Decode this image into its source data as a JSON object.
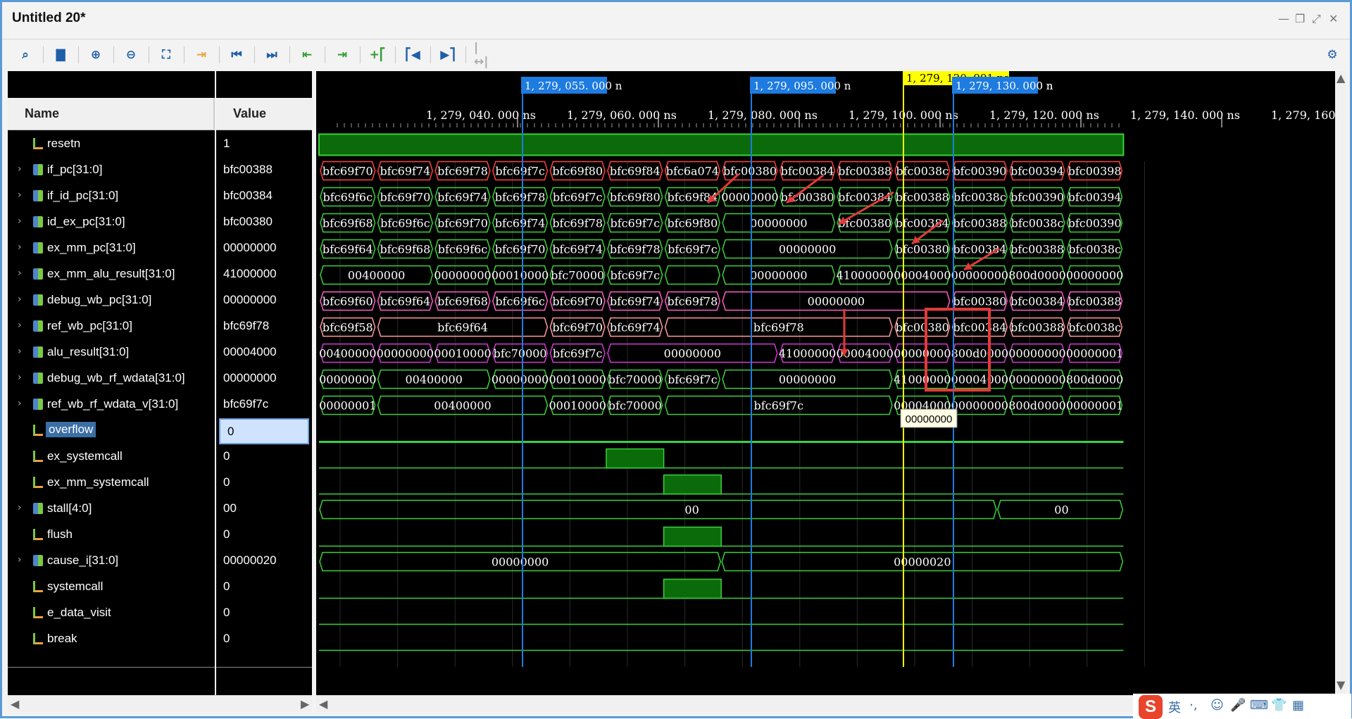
{
  "window": {
    "title": "Untitled 20*"
  },
  "toolbar": {
    "icons": [
      "search-icon",
      "save-icon",
      "zoom-in-icon",
      "zoom-out-icon",
      "zoom-fit-icon",
      "go-to-cursor-icon",
      "go-to-start-icon",
      "go-to-end-icon",
      "previous-transition-icon",
      "next-transition-icon",
      "add-marker-icon",
      "previous-marker-icon",
      "next-marker-icon",
      "swap-cursors-icon"
    ],
    "settings_icon": "gear-icon"
  },
  "columns": {
    "name": "Name",
    "value": "Value"
  },
  "signals": [
    {
      "name": "resetn",
      "value": "1",
      "bus": false
    },
    {
      "name": "if_pc[31:0]",
      "value": "bfc00388",
      "bus": true
    },
    {
      "name": "if_id_pc[31:0]",
      "value": "bfc00384",
      "bus": true
    },
    {
      "name": "id_ex_pc[31:0]",
      "value": "bfc00380",
      "bus": true
    },
    {
      "name": "ex_mm_pc[31:0]",
      "value": "00000000",
      "bus": true
    },
    {
      "name": "ex_mm_alu_result[31:0]",
      "value": "41000000",
      "bus": true
    },
    {
      "name": "debug_wb_pc[31:0]",
      "value": "00000000",
      "bus": true
    },
    {
      "name": "ref_wb_pc[31:0]",
      "value": "bfc69f78",
      "bus": true
    },
    {
      "name": "alu_result[31:0]",
      "value": "00004000",
      "bus": true
    },
    {
      "name": "debug_wb_rf_wdata[31:0]",
      "value": "00000000",
      "bus": true
    },
    {
      "name": "ref_wb_rf_wdata_v[31:0]",
      "value": "bfc69f7c",
      "bus": true
    },
    {
      "name": "overflow",
      "value": "0",
      "bus": false
    },
    {
      "name": "ex_systemcall",
      "value": "0",
      "bus": false
    },
    {
      "name": "ex_mm_systemcall",
      "value": "0",
      "bus": false
    },
    {
      "name": "stall[4:0]",
      "value": "00",
      "bus": true
    },
    {
      "name": "flush",
      "value": "0",
      "bus": false
    },
    {
      "name": "cause_i[31:0]",
      "value": "00000020",
      "bus": true
    },
    {
      "name": "systemcall",
      "value": "0",
      "bus": false
    },
    {
      "name": "e_data_visit",
      "value": "0",
      "bus": false
    },
    {
      "name": "break",
      "value": "0",
      "bus": false
    }
  ],
  "time_axis": {
    "ticks": [
      "1, 279, 040. 000 ns",
      "1, 279, 060. 000 ns",
      "1, 279, 080. 000 ns",
      "1, 279, 100. 000 ns",
      "1, 279, 120. 000 ns",
      "1, 279, 140. 000 ns",
      "1, 279, 160."
    ],
    "markers": [
      "1, 279, 055. 000 n",
      "1, 279, 095. 000 n",
      "1, 279, 130. 000 n"
    ],
    "cursor": "1, 279, 120. 991 ns",
    "marker_color": "#1e7be0",
    "cursor_color": "#ffff00"
  },
  "tooltip": "00000000",
  "bus_rows": [
    {
      "color": "#ff4040",
      "segs": [
        [
          "bfc69f70",
          0,
          1
        ],
        [
          "bfc69f74",
          1,
          2
        ],
        [
          "bfc69f78",
          2,
          3
        ],
        [
          "bfc69f7c",
          3,
          4
        ],
        [
          "bfc69f80",
          4,
          5
        ],
        [
          "bfc69f84",
          5,
          6
        ],
        [
          "bfc6a074",
          6,
          7
        ],
        [
          "bfc00380",
          7,
          8
        ],
        [
          "bfc00384",
          8,
          9
        ],
        [
          "bfc00388",
          9,
          10
        ],
        [
          "bfc0038c",
          10,
          11
        ],
        [
          "bfc00390",
          11,
          12
        ],
        [
          "bfc00394",
          12,
          13
        ],
        [
          "bfc00398",
          13,
          14
        ]
      ]
    },
    {
      "color": "#3ad13a",
      "segs": [
        [
          "bfc69f6c",
          0,
          1
        ],
        [
          "bfc69f70",
          1,
          2
        ],
        [
          "bfc69f74",
          2,
          3
        ],
        [
          "bfc69f78",
          3,
          4
        ],
        [
          "bfc69f7c",
          4,
          5
        ],
        [
          "bfc69f80",
          5,
          6
        ],
        [
          "bfc69f84",
          6,
          7
        ],
        [
          "00000000",
          7,
          8
        ],
        [
          "bfc00380",
          8,
          9
        ],
        [
          "bfc00384",
          9,
          10
        ],
        [
          "bfc00388",
          10,
          11
        ],
        [
          "bfc0038c",
          11,
          12
        ],
        [
          "bfc00390",
          12,
          13
        ],
        [
          "bfc00394",
          13,
          14
        ]
      ]
    },
    {
      "color": "#3ad13a",
      "segs": [
        [
          "bfc69f68",
          0,
          1
        ],
        [
          "bfc69f6c",
          1,
          2
        ],
        [
          "bfc69f70",
          2,
          3
        ],
        [
          "bfc69f74",
          3,
          4
        ],
        [
          "bfc69f78",
          4,
          5
        ],
        [
          "bfc69f7c",
          5,
          6
        ],
        [
          "bfc69f80",
          6,
          7
        ],
        [
          "00000000",
          7,
          9
        ],
        [
          "bfc00380",
          9,
          10
        ],
        [
          "bfc00384",
          10,
          11
        ],
        [
          "bfc00388",
          11,
          12
        ],
        [
          "bfc0038c",
          12,
          13
        ],
        [
          "bfc00390",
          13,
          14
        ]
      ]
    },
    {
      "color": "#3ad13a",
      "segs": [
        [
          "bfc69f64",
          0,
          1
        ],
        [
          "bfc69f68",
          1,
          2
        ],
        [
          "bfc69f6c",
          2,
          3
        ],
        [
          "bfc69f70",
          3,
          4
        ],
        [
          "bfc69f74",
          4,
          5
        ],
        [
          "bfc69f78",
          5,
          6
        ],
        [
          "bfc69f7c",
          6,
          7
        ],
        [
          "00000000",
          7,
          10
        ],
        [
          "bfc00380",
          10,
          11
        ],
        [
          "bfc00384",
          11,
          12
        ],
        [
          "bfc00388",
          12,
          13
        ],
        [
          "bfc0038c",
          13,
          14
        ]
      ]
    },
    {
      "color": "#3ad13a",
      "segs": [
        [
          "00400000",
          0,
          2
        ],
        [
          "00000000",
          2,
          3
        ],
        [
          "00010000",
          3,
          4
        ],
        [
          "bfc70000",
          4,
          5
        ],
        [
          "bfc69f7c",
          5,
          6
        ],
        [
          "",
          6,
          7
        ],
        [
          "00000000",
          7,
          9
        ],
        [
          "41000000",
          9,
          10
        ],
        [
          "00004000",
          10,
          11
        ],
        [
          "00000000",
          11,
          12
        ],
        [
          "800d0000",
          12,
          13
        ],
        [
          "00000000",
          13,
          14
        ]
      ]
    },
    {
      "color": "#ff5cc8",
      "segs": [
        [
          "bfc69f60",
          0,
          1
        ],
        [
          "bfc69f64",
          1,
          2
        ],
        [
          "bfc69f68",
          2,
          3
        ],
        [
          "bfc69f6c",
          3,
          4
        ],
        [
          "bfc69f70",
          4,
          5
        ],
        [
          "bfc69f74",
          5,
          6
        ],
        [
          "bfc69f78",
          6,
          7
        ],
        [
          "00000000",
          7,
          11
        ],
        [
          "bfc00380",
          11,
          12
        ],
        [
          "bfc00384",
          12,
          13
        ],
        [
          "bfc00388",
          13,
          14
        ]
      ]
    },
    {
      "color": "#ff9a9a",
      "segs": [
        [
          "bfc69f58",
          0,
          1
        ],
        [
          "bfc69f64",
          1,
          4
        ],
        [
          "bfc69f70",
          4,
          5
        ],
        [
          "bfc69f74",
          5,
          6
        ],
        [
          "bfc69f78",
          6,
          10
        ],
        [
          "bfc00380",
          10,
          11
        ],
        [
          "bfc00384",
          11,
          12
        ],
        [
          "bfc00388",
          12,
          13
        ],
        [
          "bfc0038c",
          13,
          14
        ]
      ]
    },
    {
      "color": "#d23ad2",
      "segs": [
        [
          "00400000",
          0,
          1
        ],
        [
          "00000000",
          1,
          2
        ],
        [
          "00010000",
          2,
          3
        ],
        [
          "bfc70000",
          3,
          4
        ],
        [
          "bfc69f7c",
          4,
          5
        ],
        [
          "00000000",
          5,
          8
        ],
        [
          "41000000",
          8,
          9
        ],
        [
          "00004000",
          9,
          10
        ],
        [
          "00000000",
          10,
          11
        ],
        [
          "800d0000",
          11,
          12
        ],
        [
          "00000000",
          12,
          13
        ],
        [
          "00000001",
          13,
          14
        ]
      ]
    },
    {
      "color": "#3ad13a",
      "segs": [
        [
          "00000000",
          0,
          1
        ],
        [
          "00400000",
          1,
          3
        ],
        [
          "00000000",
          3,
          4
        ],
        [
          "00010000",
          4,
          5
        ],
        [
          "bfc70000",
          5,
          6
        ],
        [
          "bfc69f7c",
          6,
          7
        ],
        [
          "00000000",
          7,
          10
        ],
        [
          "41000000",
          10,
          11
        ],
        [
          "00004000",
          11,
          12
        ],
        [
          "00000000",
          12,
          13
        ],
        [
          "800d0000",
          13,
          14
        ]
      ]
    },
    {
      "color": "#3ad13a",
      "segs": [
        [
          "00000001",
          0,
          1
        ],
        [
          "00400000",
          1,
          4
        ],
        [
          "00010000",
          4,
          5
        ],
        [
          "bfc70000",
          5,
          6
        ],
        [
          "bfc69f7c",
          6,
          10
        ],
        [
          "00004000",
          10,
          11
        ],
        [
          "00000000",
          11,
          12
        ],
        [
          "800d0000",
          12,
          13
        ],
        [
          "00000001",
          13,
          14
        ]
      ]
    }
  ],
  "stall_values": [
    "00",
    "00"
  ],
  "cause_values": [
    "00000000",
    "00000020"
  ]
}
